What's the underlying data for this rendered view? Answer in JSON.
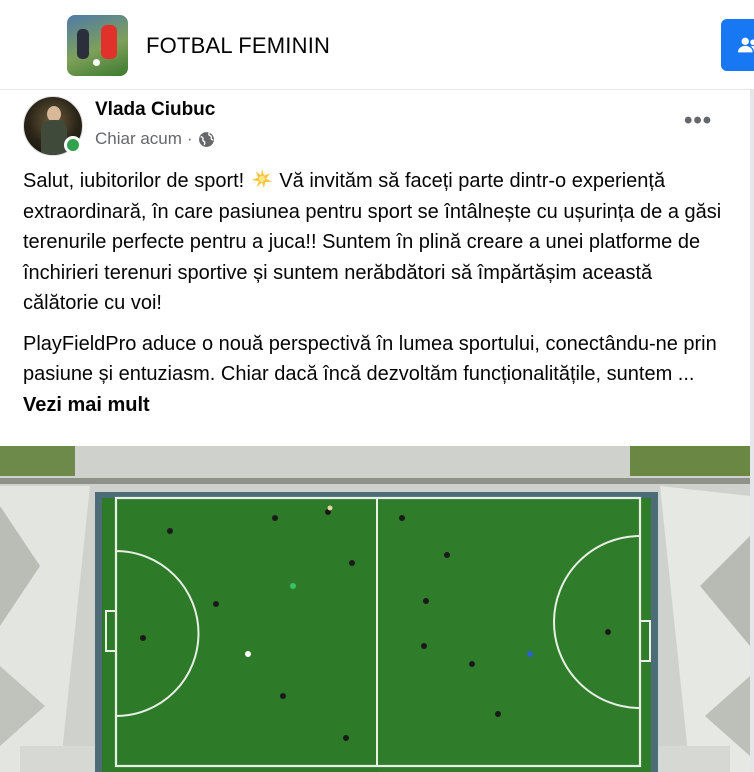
{
  "group": {
    "title": "FOTBAL FEMININ",
    "thumbnail_icon": "group-photo-icon",
    "join_icon": "people-icon",
    "accent": "#1877f2"
  },
  "post": {
    "author": "Vlada Ciubuc",
    "time": "Chiar acum",
    "separator": "·",
    "audience_icon": "globe-icon",
    "online_color": "#31a24c",
    "more_label": "•••",
    "paragraph1_a": "Salut, iubitorilor de sport! ",
    "paragraph1_b": " Vă invităm să faceți parte dintr-o experiență extraordinară, în care pasiunea pentru sport se întâlnește cu ușurința de a găsi terenurile perfecte pentru a juca!! Suntem în plină creare a unei platforme de închirieri terenuri sportive și suntem nerăbdători să împărtășim această călătorie cu voi!",
    "emoji_icon": "sparkle-icon",
    "paragraph2": "PlayFieldPro aduce o nouă perspectivă în lumea sportului, conectându-ne prin pasiune și entuziasm. Chiar dacă încă dezvoltăm funcționalitățile, suntem ... ",
    "see_more": "Vezi mai mult",
    "image_icon": "football-pitch-aerial-photo"
  }
}
